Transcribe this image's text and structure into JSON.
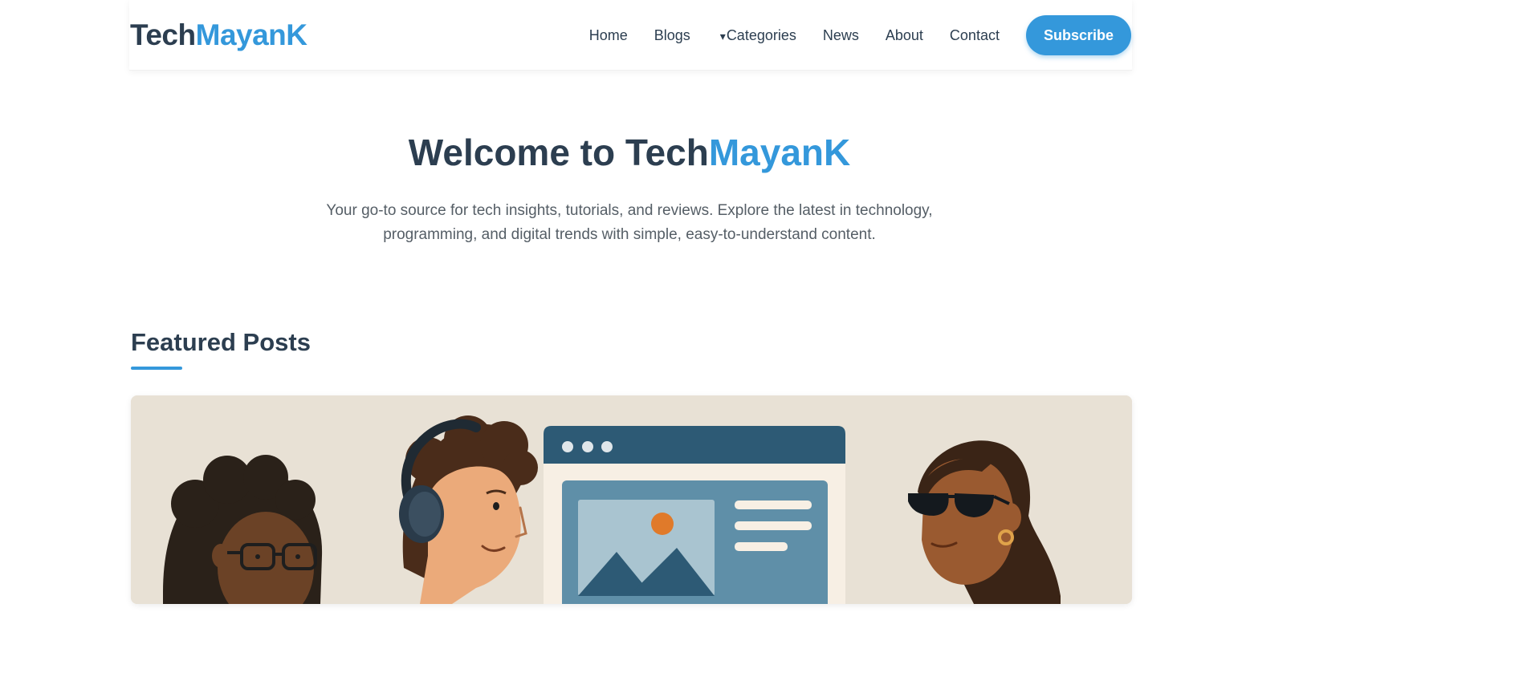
{
  "header": {
    "logo_part1": "Tech",
    "logo_part2": "MayanK",
    "nav": {
      "home": "Home",
      "blogs": "Blogs",
      "categories_caret": "▾",
      "categories": "Categories",
      "news": "News",
      "about": "About",
      "contact": "Contact"
    },
    "subscribe": "Subscribe"
  },
  "hero": {
    "title_part1": "Welcome to Tech",
    "title_part2": "MayanK",
    "description": "Your go-to source for tech insights, tutorials, and reviews. Explore the latest in technology, programming, and digital trends with simple, easy-to-understand content."
  },
  "featured": {
    "heading": "Featured Posts"
  },
  "colors": {
    "primary": "#3498db",
    "dark": "#2c3e50",
    "text_muted": "#555e66",
    "card_bg": "#e8e1d5"
  }
}
